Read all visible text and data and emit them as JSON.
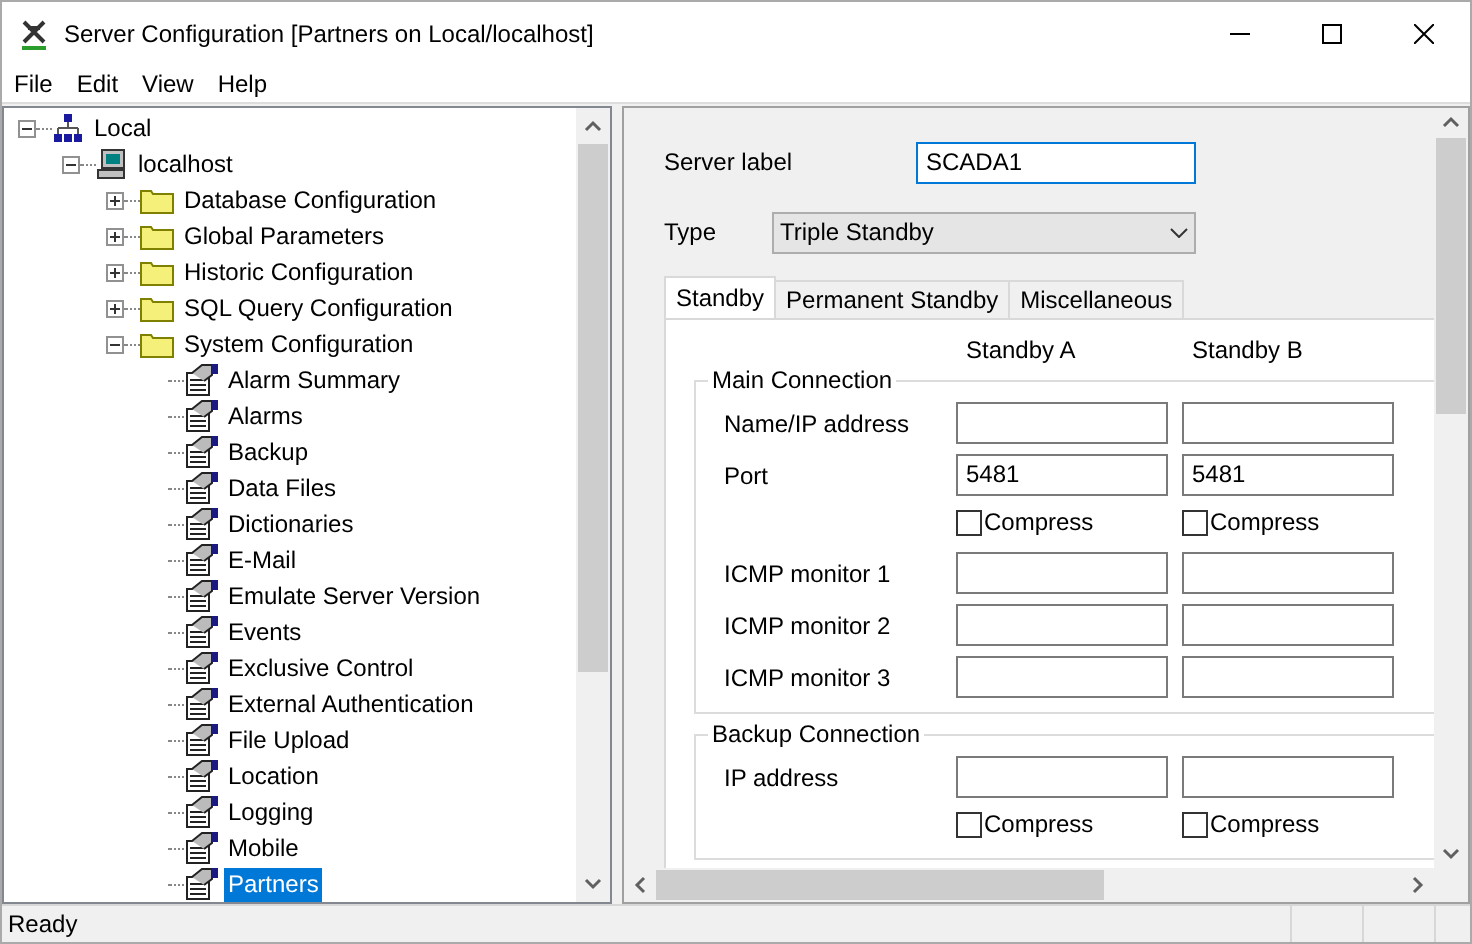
{
  "window": {
    "title": "Server Configuration [Partners on Local/localhost]"
  },
  "menu": [
    "File",
    "Edit",
    "View",
    "Help"
  ],
  "tree": [
    {
      "label": "Local",
      "kind": "network",
      "expanded": true,
      "selected": false,
      "children": [
        {
          "label": "localhost",
          "kind": "computer",
          "expanded": true,
          "selected": false,
          "children": [
            {
              "label": "Database Configuration",
              "kind": "folder",
              "expanded": false,
              "selected": false
            },
            {
              "label": "Global Parameters",
              "kind": "folder",
              "expanded": false,
              "selected": false
            },
            {
              "label": "Historic Configuration",
              "kind": "folder",
              "expanded": false,
              "selected": false
            },
            {
              "label": "SQL Query Configuration",
              "kind": "folder",
              "expanded": false,
              "selected": false
            },
            {
              "label": "System Configuration",
              "kind": "folder",
              "expanded": true,
              "selected": false,
              "children": [
                {
                  "label": "Alarm Summary",
                  "kind": "page",
                  "selected": false
                },
                {
                  "label": "Alarms",
                  "kind": "page",
                  "selected": false
                },
                {
                  "label": "Backup",
                  "kind": "page",
                  "selected": false
                },
                {
                  "label": "Data Files",
                  "kind": "page",
                  "selected": false
                },
                {
                  "label": "Dictionaries",
                  "kind": "page",
                  "selected": false
                },
                {
                  "label": "E-Mail",
                  "kind": "page",
                  "selected": false
                },
                {
                  "label": "Emulate Server Version",
                  "kind": "page",
                  "selected": false
                },
                {
                  "label": "Events",
                  "kind": "page",
                  "selected": false
                },
                {
                  "label": "Exclusive Control",
                  "kind": "page",
                  "selected": false
                },
                {
                  "label": "External Authentication",
                  "kind": "page",
                  "selected": false
                },
                {
                  "label": "File Upload",
                  "kind": "page",
                  "selected": false
                },
                {
                  "label": "Location",
                  "kind": "page",
                  "selected": false
                },
                {
                  "label": "Logging",
                  "kind": "page",
                  "selected": false
                },
                {
                  "label": "Mobile",
                  "kind": "page",
                  "selected": false
                },
                {
                  "label": "Partners",
                  "kind": "page",
                  "selected": true
                }
              ]
            }
          ]
        }
      ]
    }
  ],
  "form": {
    "server_label": {
      "label": "Server label",
      "value": "SCADA1"
    },
    "type": {
      "label": "Type",
      "value": "Triple Standby"
    },
    "tabs": [
      {
        "label": "Standby",
        "selected": true
      },
      {
        "label": "Permanent Standby",
        "selected": false
      },
      {
        "label": "Miscellaneous",
        "selected": false
      }
    ],
    "columns": [
      "Standby A",
      "Standby B"
    ],
    "groups": [
      {
        "title": "Main Connection",
        "rows": [
          {
            "kind": "input",
            "label": "Name/IP address"
          },
          {
            "kind": "input",
            "label": "Port",
            "values": [
              "5481",
              "5481"
            ]
          },
          {
            "kind": "checkbox",
            "options": [
              {
                "label": "Compress",
                "checked": false
              },
              {
                "label": "Compress",
                "checked": false
              }
            ]
          },
          {
            "kind": "input",
            "label": "ICMP monitor 1"
          },
          {
            "kind": "input",
            "label": "ICMP monitor 2"
          },
          {
            "kind": "input",
            "label": "ICMP monitor 3"
          }
        ]
      },
      {
        "title": "Backup Connection",
        "rows": [
          {
            "kind": "input",
            "label": "IP address"
          },
          {
            "kind": "checkbox",
            "options": [
              {
                "label": "Compress",
                "checked": false
              },
              {
                "label": "Compress",
                "checked": false
              }
            ]
          }
        ]
      }
    ]
  },
  "status_bar": {
    "text": "Ready"
  }
}
